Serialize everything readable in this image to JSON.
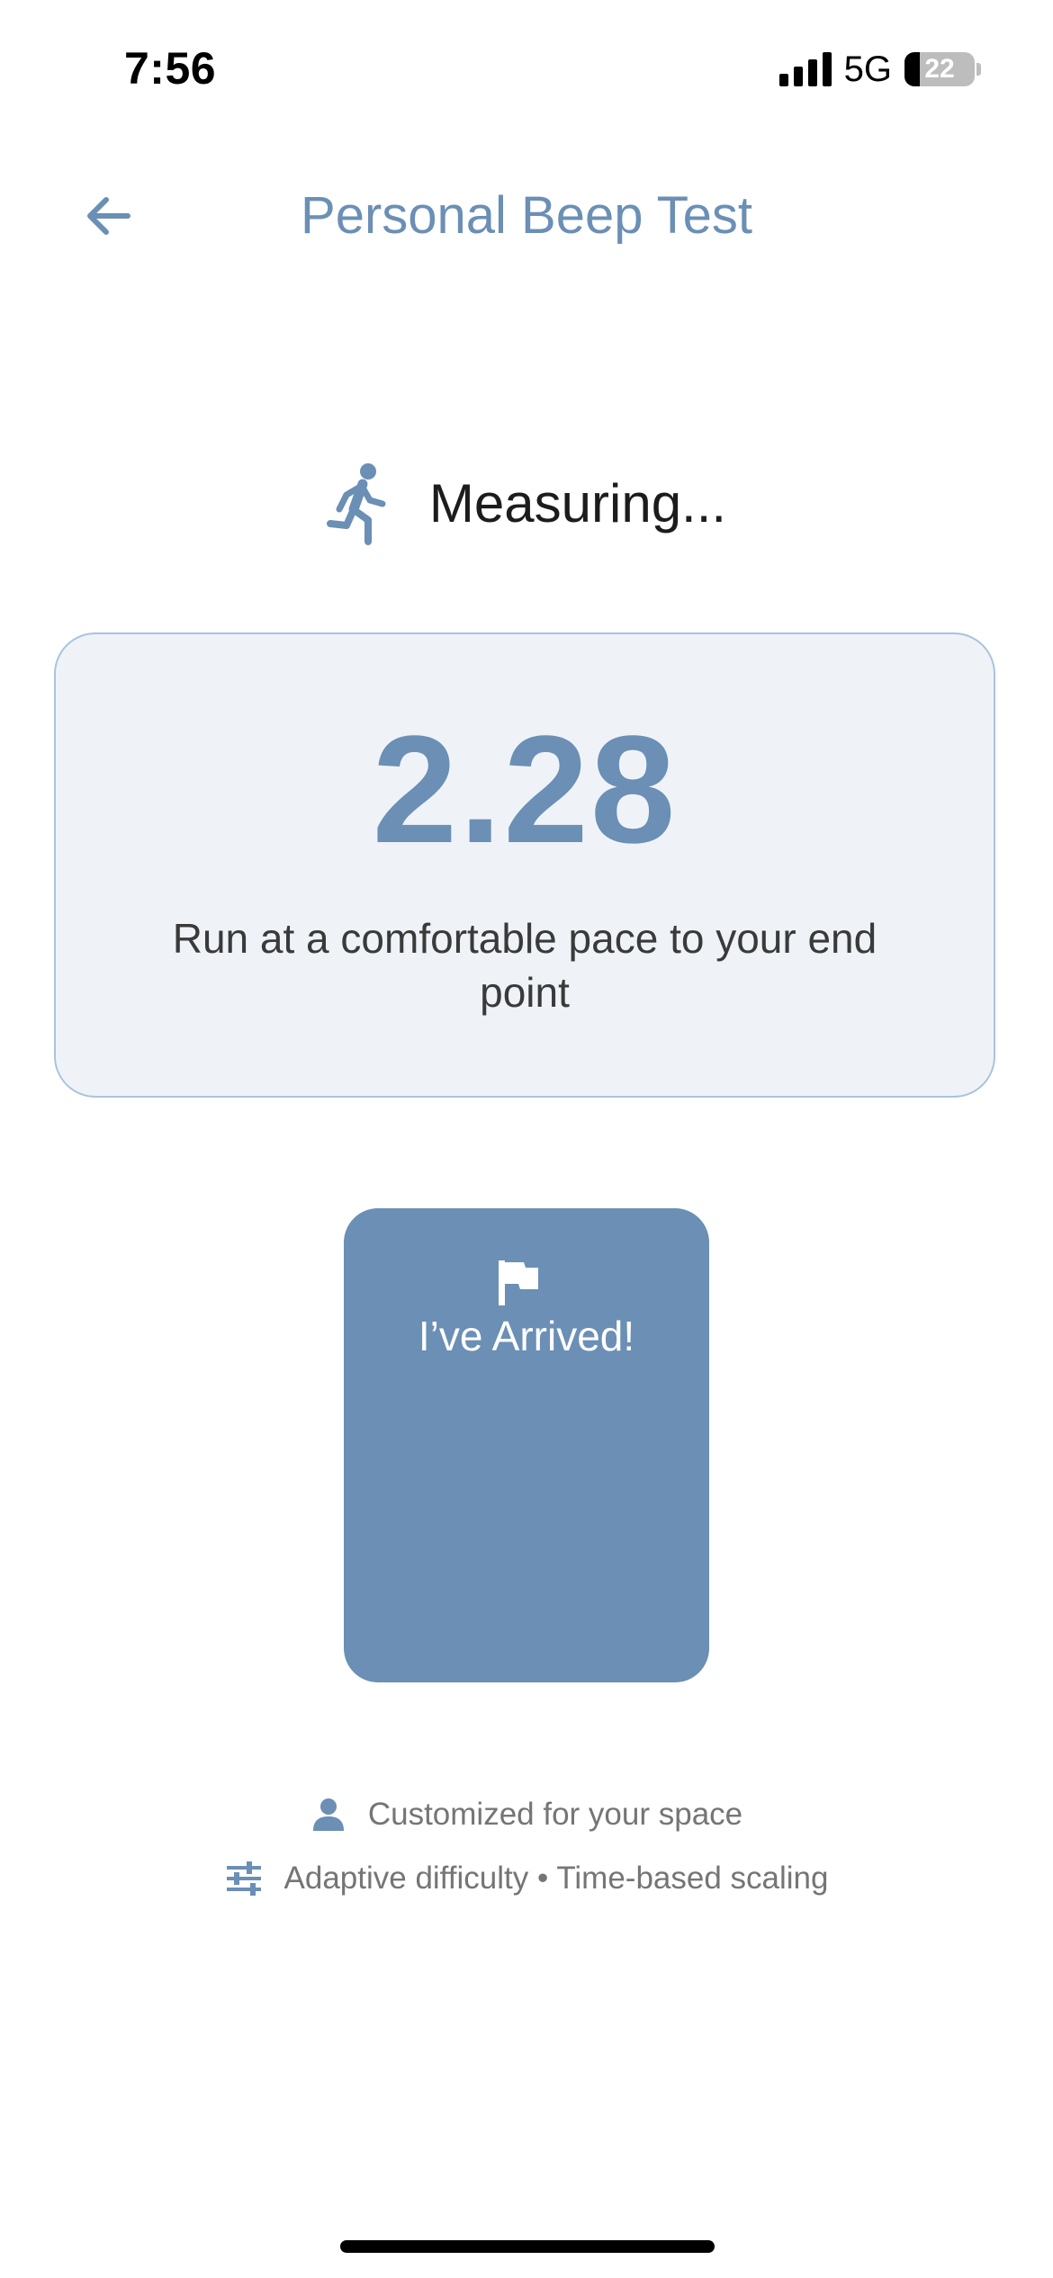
{
  "status_bar": {
    "time": "7:56",
    "network": "5G",
    "battery_level": "22"
  },
  "header": {
    "title": "Personal Beep Test",
    "back_icon": "arrow-left-icon"
  },
  "status": {
    "label": "Measuring...",
    "icon": "running-person-icon"
  },
  "measurement": {
    "value": "2.28",
    "instruction": "Run at a comfortable pace to your end point"
  },
  "arrived_button": {
    "label": "I’ve Arrived!",
    "icon": "flag-icon"
  },
  "info": {
    "line1": {
      "icon": "person-icon",
      "text": "Customized for your space"
    },
    "line2": {
      "icon": "sliders-icon",
      "text": "Adaptive difficulty • Time-based scaling"
    }
  },
  "colors": {
    "accent": "#6b8fb5",
    "card_background": "#eff3f8",
    "card_border": "#a9c3dd",
    "muted_text": "#757575"
  }
}
